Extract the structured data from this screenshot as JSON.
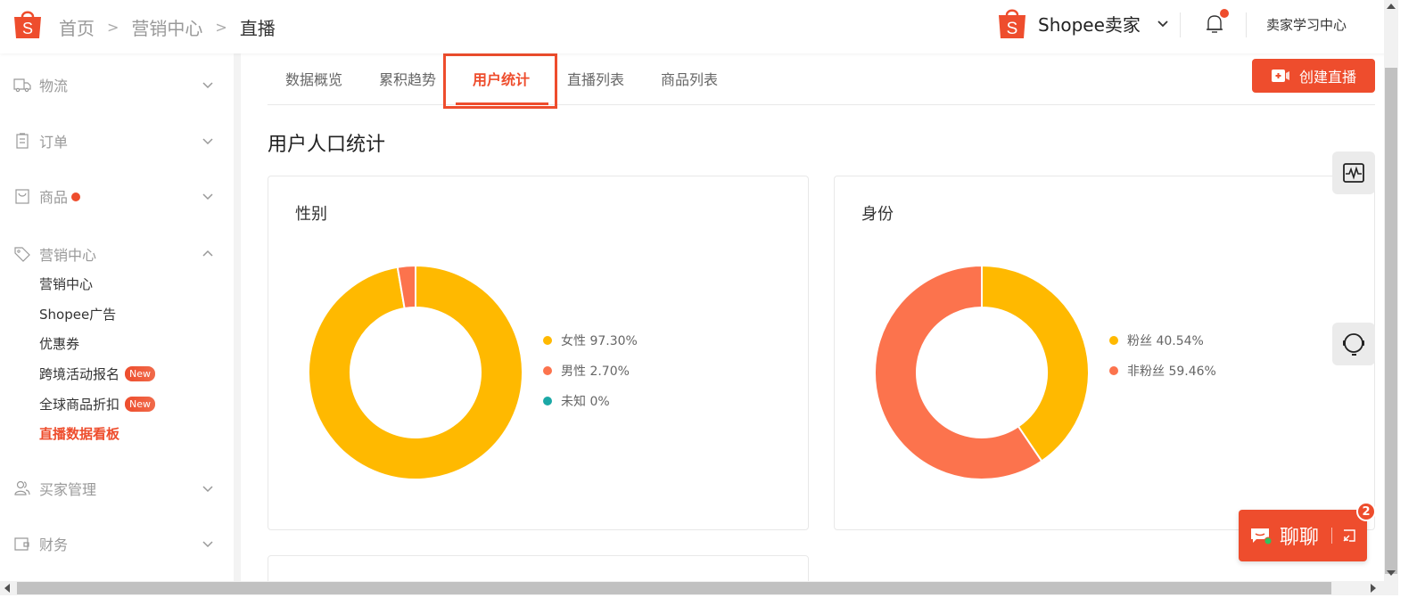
{
  "header": {
    "breadcrumb": [
      "首页",
      "营销中心",
      "直播"
    ],
    "seller_name": "Shopee卖家",
    "learn_center": "卖家学习中心",
    "brand_color": "#ee4d2d"
  },
  "sidebar": {
    "groups": [
      {
        "label": "物流",
        "icon": "truck-icon",
        "expanded": false
      },
      {
        "label": "订单",
        "icon": "clipboard-icon",
        "expanded": false
      },
      {
        "label": "商品",
        "icon": "bag-icon",
        "expanded": false,
        "dot": true
      },
      {
        "label": "营销中心",
        "icon": "tag-icon",
        "expanded": true
      },
      {
        "label": "买家管理",
        "icon": "users-icon",
        "expanded": false
      },
      {
        "label": "财务",
        "icon": "wallet-icon",
        "expanded": false
      }
    ],
    "marketing_items": [
      {
        "label": "营销中心"
      },
      {
        "label": "Shopee广告"
      },
      {
        "label": "优惠券"
      },
      {
        "label": "跨境活动报名",
        "badge": "New"
      },
      {
        "label": "全球商品折扣",
        "badge": "New"
      },
      {
        "label": "直播数据看板",
        "active": true
      }
    ]
  },
  "tabs": [
    {
      "label": "数据概览"
    },
    {
      "label": "累积趋势"
    },
    {
      "label": "用户统计",
      "active": true
    },
    {
      "label": "直播列表"
    },
    {
      "label": "商品列表"
    }
  ],
  "create_button": "创建直播",
  "section_title": "用户人口统计",
  "chat": {
    "label": "聊聊",
    "badge": "2"
  },
  "chart_data": [
    {
      "type": "pie",
      "title": "性别",
      "donut": true,
      "legend_position": "right",
      "slices": [
        {
          "name": "女性",
          "value": 97.3,
          "label": "女性 97.30%",
          "color": "#ffb900"
        },
        {
          "name": "男性",
          "value": 2.7,
          "label": "男性 2.70%",
          "color": "#fc734d"
        },
        {
          "name": "未知",
          "value": 0,
          "label": "未知 0%",
          "color": "#1ba8a6"
        }
      ]
    },
    {
      "type": "pie",
      "title": "身份",
      "donut": true,
      "legend_position": "right",
      "slices": [
        {
          "name": "粉丝",
          "value": 40.54,
          "label": "粉丝 40.54%",
          "color": "#ffb900"
        },
        {
          "name": "非粉丝",
          "value": 59.46,
          "label": "非粉丝 59.46%",
          "color": "#fc734d"
        }
      ]
    }
  ]
}
